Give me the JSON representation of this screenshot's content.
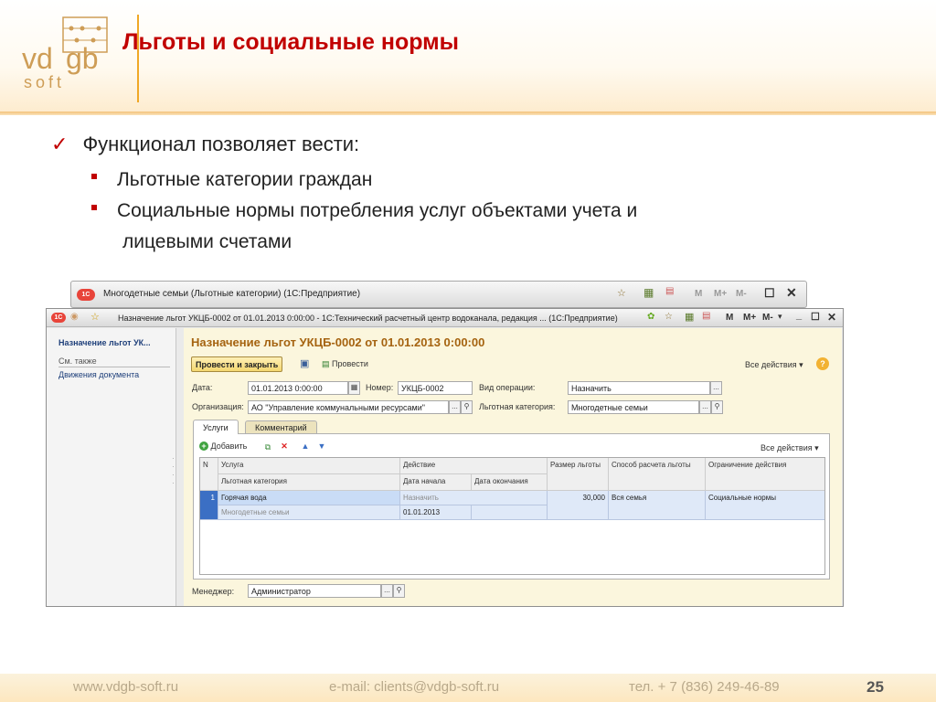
{
  "slide": {
    "title": "Льготы и социальные нормы",
    "logo": {
      "vd": "vd",
      "g": "gb",
      "soft": "soft"
    },
    "bullet_main": "Функционал позволяет вести:",
    "bullets": [
      "Льготные категории граждан",
      "Социальные нормы потребления услуг объектами учета и",
      "лицевыми счетами"
    ],
    "footer": {
      "site": "www.vdgb-soft.ru",
      "email": "e-mail: clients@vdgb-soft.ru",
      "phone": "тел. + 7 (836) 249-46-89",
      "page": "25"
    }
  },
  "back_window": {
    "logo": "1С",
    "title": "Многодетные семьи (Льготные категории)  (1С:Предприятие)",
    "toolbar": [
      "M",
      "M+",
      "M-"
    ]
  },
  "main_window": {
    "logo": "1С",
    "title": "Назначение льгот УКЦБ-0002 от 01.01.2013 0:00:00 - 1С:Технический расчетный центр водоканала, редакция ...  (1С:Предприятие)",
    "toolbar": [
      "M",
      "M+",
      "M-"
    ],
    "sidebar": {
      "header": "Назначение льгот УК...",
      "see_also": "См. также",
      "link": "Движения документа"
    },
    "doc": {
      "title": "Назначение льгот УКЦБ-0002 от 01.01.2013 0:00:00",
      "btn_post_close": "Провести и закрыть",
      "btn_post": "Провести",
      "all_actions": "Все действия",
      "date_label": "Дата:",
      "date_value": "01.01.2013  0:00:00",
      "number_label": "Номер:",
      "number_value": "УКЦБ-0002",
      "optype_label": "Вид операции:",
      "optype_value": "Назначить",
      "org_label": "Организация:",
      "org_value": "АО \"Управление коммунальными ресурсами\"",
      "category_label": "Льготная категория:",
      "category_value": "Многодетные семьи",
      "tabs": [
        "Услуги",
        "Комментарий"
      ],
      "add_label": "Добавить",
      "grid_all_actions": "Все действия",
      "grid_headers": {
        "n": "N",
        "service": "Услуга",
        "category": "Льготная категория",
        "action": "Действие",
        "start": "Дата начала",
        "end": "Дата окончания",
        "size": "Размер льготы",
        "method": "Способ расчета льготы",
        "limit": "Ограничение действия"
      },
      "rows": [
        {
          "n": "1",
          "service": "Горячая вода",
          "category": "Многодетные семьи",
          "action": "Назначить",
          "start": "01.01.2013",
          "end": "",
          "size": "30,000",
          "method": "Вся семья",
          "limit": "Социальные нормы"
        }
      ],
      "manager_label": "Менеджер:",
      "manager_value": "Администратор"
    }
  }
}
